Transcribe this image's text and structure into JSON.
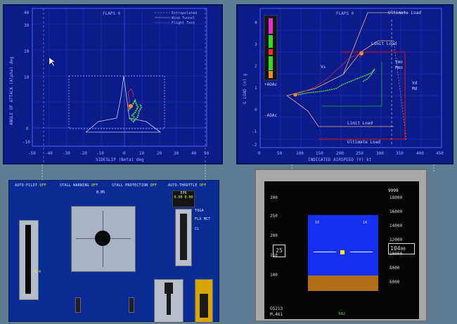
{
  "left_plot": {
    "flaps": "FLAPS 0",
    "legend": [
      "Extrapolated",
      "Wind Tunnel",
      "Flight Test"
    ],
    "y_label": "ANGLE OF ATTACK (Alpha) deg",
    "x_label": "SIDESLIP (Beta) deg",
    "y_ticks": [
      "40",
      "30",
      "20",
      "10",
      "0",
      "-10"
    ],
    "x_ticks": [
      "-50",
      "-40",
      "-30",
      "-20",
      "-10",
      "0",
      "10",
      "20",
      "30",
      "40",
      "50"
    ]
  },
  "right_plot": {
    "flaps": "FLAPS 0",
    "y_label": "G LOAD (n) g",
    "x_label": "INDICATED AIRSPEED (V) kt",
    "y_ticks": [
      "4",
      "3",
      "2",
      "1",
      "0",
      "-1",
      "-2"
    ],
    "x_ticks": [
      "0",
      "50",
      "100",
      "150",
      "200",
      "250",
      "300",
      "350",
      "400",
      "450"
    ],
    "labels": {
      "ultimate_load_top": "Ultimate Load",
      "limit_load_top": "Limit Load",
      "vmo": "Vmo",
      "mmo": "Mmo",
      "vd": "Vd",
      "md": "Md",
      "vs": "Vs",
      "aoac_plus": "+AOAc",
      "aoac_minus": "-AOAc",
      "limit_load_bottom": "Limit Load",
      "ultimate_load_bottom": "Ultimate Load"
    }
  },
  "controls": {
    "autopilot": "AUTO-PILOT",
    "stall_warning": "STALL WARNING",
    "stall_protection": "STALL PROTECTION",
    "autothrottle": "AUTO-THROTTLE",
    "off": "OFF",
    "epr_label": "EPR",
    "epr_values": "0.00 0.00",
    "toga": "TOGA",
    "flx_mct": "FLX MCT",
    "cl": "CL",
    "zero": "0",
    "trim_value": "-0.4",
    "pitch_readout": "0.05"
  },
  "pfd": {
    "speed_ticks": [
      "300",
      "250",
      "200",
      "150",
      "100"
    ],
    "speed_box": "25",
    "alt_ticks": [
      "18000",
      "16000",
      "14000",
      "12000",
      "10000",
      "8000",
      "6000"
    ],
    "alt_box": "104",
    "alt_box_tail": "00",
    "alt_target": "9999",
    "gs": "GS213",
    "mach": "M.461",
    "pitch_ticks": [
      "10",
      "10"
    ],
    "heading": "RA2"
  },
  "colors": {
    "panel_blue": "#0d1a8a",
    "plot_line": "#7a8cff",
    "envelope": "#f0b183",
    "green_box": "#0fb80f",
    "red_box": "#d11",
    "flight_green": "#4cd94c",
    "flight_red": "#e33",
    "off_yellow": "#e6ef3a"
  }
}
